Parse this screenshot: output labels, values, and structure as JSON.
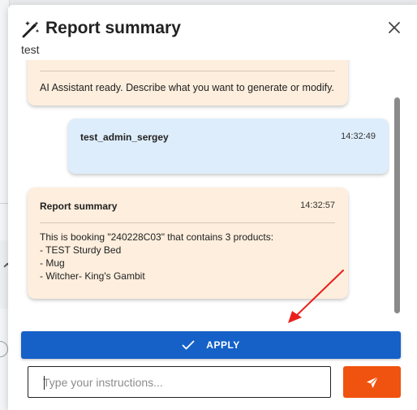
{
  "dialog": {
    "title": "Report summary",
    "subtitle": "test",
    "header_icon": "magic-wand-icon",
    "close_icon": "close-icon"
  },
  "messages": [
    {
      "role": "assistant",
      "text": "AI Assistant ready. Describe what you want to generate or modify."
    },
    {
      "role": "user",
      "sender": "test_admin_sergey",
      "time": "14:32:49"
    },
    {
      "role": "assistant",
      "sender": "Report summary",
      "time": "14:32:57",
      "lines": [
        "This is booking \"240228C03\" that contains 3 products:",
        "- TEST Sturdy Bed",
        "- Mug",
        "- Witcher- King's Gambit"
      ]
    }
  ],
  "actions": {
    "apply_label": "APPLY",
    "apply_icon": "check-icon",
    "send_icon": "send-icon"
  },
  "input": {
    "placeholder": "Type your instructions...",
    "value": ""
  },
  "colors": {
    "assistant_bubble": "#fdeedd",
    "user_bubble": "#deedfb",
    "apply_button": "#1561c8",
    "send_button": "#f0520f",
    "annotation_arrow": "#e8211d"
  },
  "annotation": {
    "type": "red-arrow",
    "points_to": "apply-button"
  }
}
